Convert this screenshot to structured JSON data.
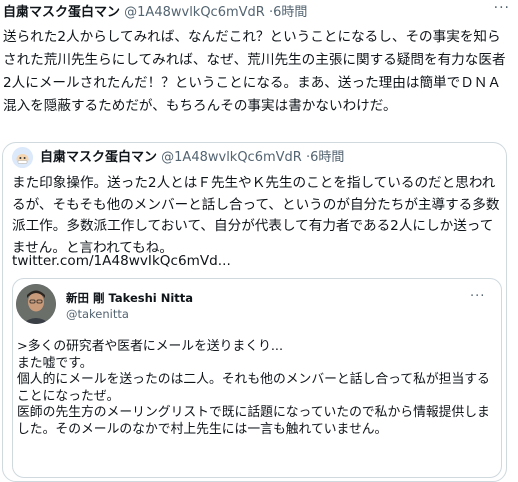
{
  "tweet": {
    "author_name": "自粛マスク蛋白マン",
    "handle": "@1A48wvlkQc6mVdR",
    "time": "6時間",
    "more_label": "···",
    "text": "送られた2人からしてみれば、なんだこれ？ということになるし、その事実を知らされた荒川先生らにしてみれば、なぜ、荒川先生の主張に関する疑問を有力な医者2人にメールされたんだ！？ということになる。まあ、送った理由は簡単でＤＮＡ混入を隠蔽するためだが、もちろんその事実は書かないわけだ。"
  },
  "quoted": {
    "author_name": "自粛マスク蛋白マン",
    "handle": "@1A48wvlkQc6mVdR",
    "time": "6時間",
    "text": "また印象操作。送った2人とはＦ先生やＫ先生のことを指しているのだと思われるが、そもそも他のメンバーと話し合って、というのが自分たちが主導する多数派工作。多数派工作しておいて、自分が代表して有力者である2人にしか送ってません。と言われてもね。",
    "link": "twitter.com/1A48wvIkQc6mVd..."
  },
  "embedded": {
    "author_name": "新田 剛 Takeshi Nitta",
    "handle": "@takenitta",
    "more_label": "···",
    "text": ">多くの研究者や医者にメールを送りまくり...\nまた嘘です。\n個人的にメールを送ったのは二人。それも他のメンバーと話し合って私が担当することになったぜ。\n医師の先生方のメーリングリストで既に話題になっていたので私から情報提供しました。そのメールのなかで村上先生には一言も触れていません。"
  }
}
